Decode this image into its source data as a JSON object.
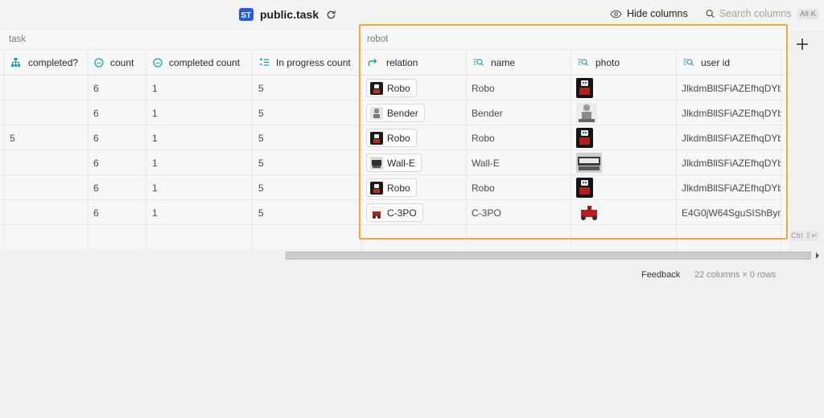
{
  "header": {
    "table_name": "public.task",
    "hide_columns_label": "Hide columns",
    "search_placeholder": "Search columns",
    "search_shortcut": "Alt K"
  },
  "groups": {
    "task": "task",
    "robot": "robot"
  },
  "columns": [
    {
      "label": "completed?",
      "icon": "hierarchy-icon"
    },
    {
      "label": "count",
      "icon": "rollup-icon"
    },
    {
      "label": "completed count",
      "icon": "rollup-icon"
    },
    {
      "label": "In progress count",
      "icon": "formula-list-icon"
    },
    {
      "label": "relation",
      "icon": "relation-arrow-icon"
    },
    {
      "label": "name",
      "icon": "lookup-icon"
    },
    {
      "label": "photo",
      "icon": "lookup-icon"
    },
    {
      "label": "user id",
      "icon": "lookup-icon"
    }
  ],
  "rows": [
    {
      "completed": "",
      "count": "6",
      "completed_count": "1",
      "in_progress": "5",
      "relation": "Robo",
      "name": "Robo",
      "photo": "robo",
      "user_id": "JlkdmBllSFiAZEfhqDYb"
    },
    {
      "completed": "",
      "count": "6",
      "completed_count": "1",
      "in_progress": "5",
      "relation": "Bender",
      "name": "Bender",
      "photo": "bender",
      "user_id": "JlkdmBllSFiAZEfhqDYb"
    },
    {
      "completed": "5",
      "count": "6",
      "completed_count": "1",
      "in_progress": "5",
      "relation": "Robo",
      "name": "Robo",
      "photo": "robo",
      "user_id": "JlkdmBllSFiAZEfhqDYb"
    },
    {
      "completed": "",
      "count": "6",
      "completed_count": "1",
      "in_progress": "5",
      "relation": "Wall-E",
      "name": "Wall-E",
      "photo": "walle",
      "user_id": "JlkdmBllSFiAZEfhqDYb"
    },
    {
      "completed": "",
      "count": "6",
      "completed_count": "1",
      "in_progress": "5",
      "relation": "Robo",
      "name": "Robo",
      "photo": "robo",
      "user_id": "JlkdmBllSFiAZEfhqDYb"
    },
    {
      "completed": "",
      "count": "6",
      "completed_count": "1",
      "in_progress": "5",
      "relation": "C-3PO",
      "name": "C-3PO",
      "photo": "c3po",
      "user_id": "E4G0jW64SguSIShBym"
    }
  ],
  "grid_hint": "Ctrl ⇧↵",
  "footer": {
    "feedback": "Feedback",
    "summary": "22 columns × 0 rows"
  },
  "colors": {
    "accent_selection": "#e9a93b",
    "icon_teal": "#1a9ea6",
    "db_icon_blue": "#2a5bd7"
  }
}
